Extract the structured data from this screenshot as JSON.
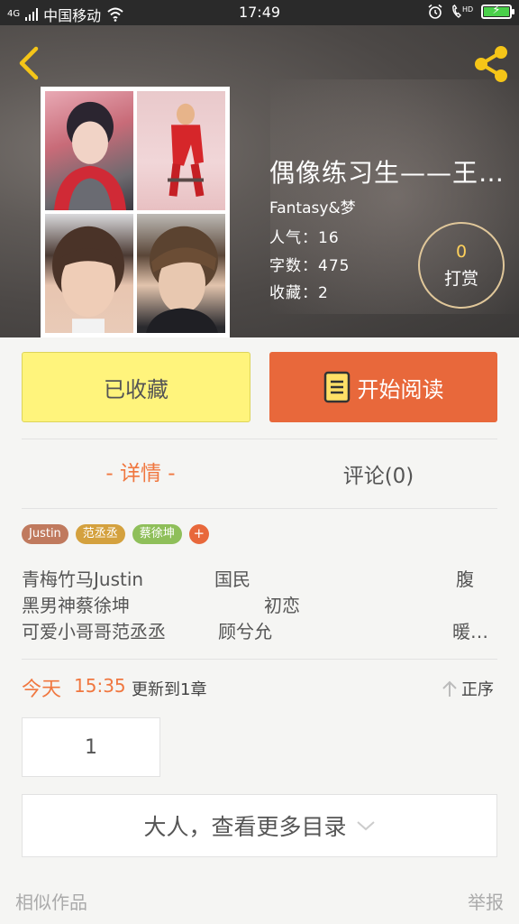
{
  "status_bar": {
    "signal": "4G",
    "carrier": "中国移动",
    "time": "17:49",
    "network": "HD"
  },
  "book": {
    "title": "偶像练习生——王…",
    "author": "Fantasy&梦",
    "popularity": "人气：16",
    "words": "字数：475",
    "favorites": "收藏：2",
    "tip_count": "0",
    "tip_label": "打赏"
  },
  "actions": {
    "favorite_label": "已收藏",
    "read_label": "开始阅读"
  },
  "tabs": [
    {
      "label": "-  详情  -",
      "active": true
    },
    {
      "label": "评论(0)",
      "active": false
    }
  ],
  "tags": [
    {
      "label": "Justin",
      "color": "#c07a5e"
    },
    {
      "label": "范丞丞",
      "color": "#d4a13e"
    },
    {
      "label": "蔡徐坤",
      "color": "#8fbf5a"
    }
  ],
  "tag_add": "+",
  "description": {
    "line1": [
      "青梅竹马Justin",
      "国民",
      "腹"
    ],
    "line2": [
      "黑男神蔡徐坤",
      "初恋"
    ],
    "line3": [
      "可爱小哥哥范丞丞",
      "顾兮允",
      "暖…"
    ]
  },
  "update": {
    "day": "今天",
    "time": "15:35",
    "text": "更新到1章",
    "sort_label": "正序"
  },
  "chapters": [
    "1"
  ],
  "more_label": "大人，查看更多目录",
  "footer": {
    "similar": "相似作品",
    "report": "举报"
  },
  "colors": {
    "accent": "#e8683b",
    "favorite_bg": "#fff47c",
    "tip_number": "#ffd15c",
    "header_bg": "#4c4846",
    "icon_yellow": "#f5c518"
  }
}
